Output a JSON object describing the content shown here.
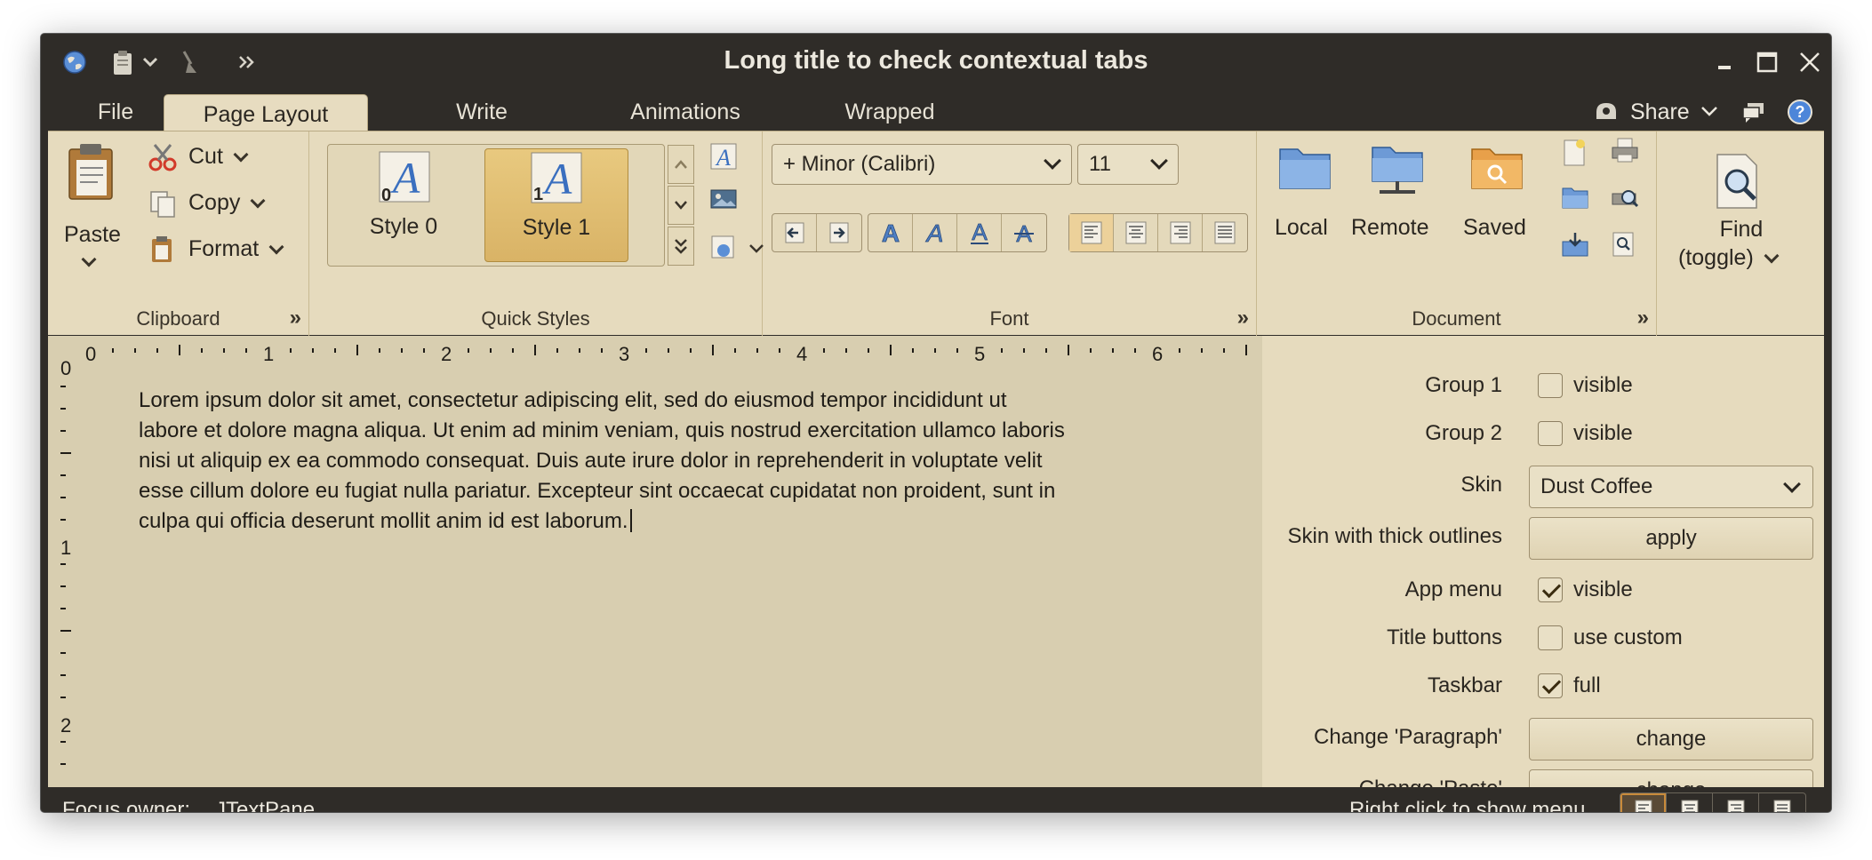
{
  "window": {
    "title": "Long title to check contextual tabs"
  },
  "taskbar": {
    "tabs": [
      {
        "label": "File",
        "selected": false
      },
      {
        "label": "Page Layout",
        "selected": true
      },
      {
        "label": "Write",
        "selected": false
      },
      {
        "label": "Animations",
        "selected": false
      },
      {
        "label": "Wrapped",
        "selected": false
      }
    ],
    "share_label": "Share"
  },
  "ribbon": {
    "clipboard": {
      "title": "Clipboard",
      "paste_label": "Paste",
      "cut_label": "Cut",
      "copy_label": "Copy",
      "format_label": "Format"
    },
    "quick_styles": {
      "title": "Quick Styles",
      "styles": [
        {
          "label": "Style 0",
          "index": "0",
          "selected": false
        },
        {
          "label": "Style 1",
          "index": "1",
          "selected": true
        }
      ]
    },
    "font": {
      "title": "Font",
      "family": "+ Minor (Calibri)",
      "size": "11"
    },
    "document": {
      "title": "Document",
      "local_label": "Local",
      "remote_label": "Remote",
      "saved_label": "Saved",
      "find_label_line1": "Find",
      "find_label_line2": "(toggle)"
    }
  },
  "ruler": {
    "h_marks": [
      "0",
      "1",
      "2",
      "3",
      "4",
      "5",
      "6"
    ],
    "v_marks": [
      "0",
      "1",
      "2"
    ]
  },
  "editor": {
    "text_lines": [
      "Lorem ipsum dolor sit amet, consectetur adipiscing elit, sed do eiusmod tempor incididunt ut",
      "labore et dolore magna aliqua. Ut enim ad minim veniam, quis nostrud exercitation ullamco laboris",
      "nisi ut aliquip ex ea commodo consequat. Duis aute irure dolor in reprehenderit in voluptate velit",
      "esse cillum dolore eu fugiat nulla pariatur. Excepteur sint occaecat cupidatat non proident, sunt in",
      "culpa qui officia deserunt mollit anim id est laborum."
    ]
  },
  "panel": {
    "group1": {
      "label": "Group 1",
      "check_text": "visible",
      "checked": false
    },
    "group2": {
      "label": "Group 2",
      "check_text": "visible",
      "checked": false
    },
    "skin": {
      "label": "Skin",
      "value": "Dust Coffee"
    },
    "thick": {
      "label": "Skin with thick outlines",
      "button": "apply"
    },
    "app_menu": {
      "label": "App menu",
      "check_text": "visible",
      "checked": true
    },
    "title_buttons": {
      "label": "Title buttons",
      "check_text": "use custom",
      "checked": false
    },
    "taskbar_opt": {
      "label": "Taskbar",
      "check_text": "full",
      "checked": true
    },
    "change_paragraph": {
      "label": "Change 'Paragraph'",
      "button": "change"
    },
    "change_paste": {
      "label": "Change 'Paste'",
      "button": "change"
    }
  },
  "status": {
    "focus_label": "Focus owner:",
    "focus_value": "JTextPane",
    "right_hint": "Right click to show menu"
  }
}
